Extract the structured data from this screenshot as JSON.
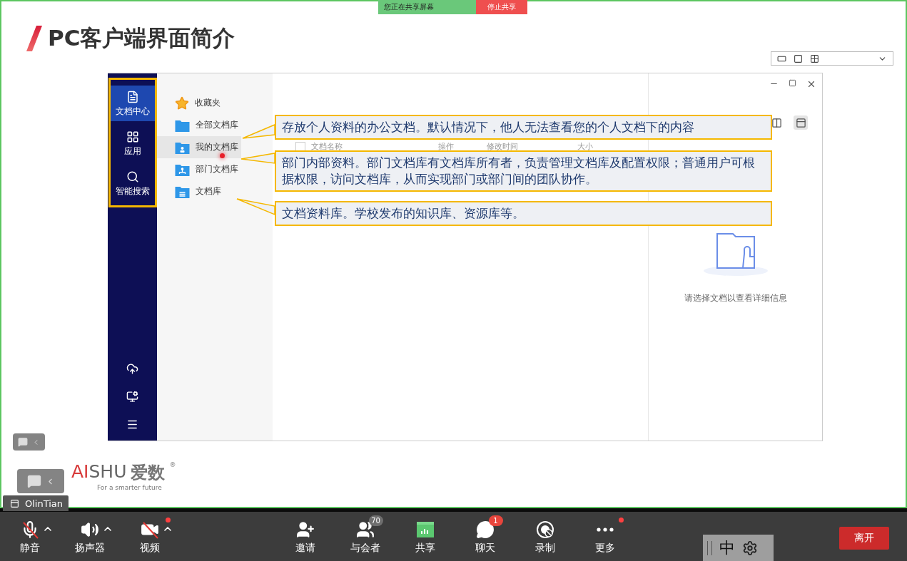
{
  "share_bar": {
    "status": "您正在共享屏幕",
    "stop_button": "停止共享"
  },
  "slide": {
    "title": "PC客户端界面简介",
    "app_window": {
      "rail_items": [
        {
          "label": "文档中心",
          "kind": "doc",
          "selected": true
        },
        {
          "label": "应用",
          "kind": "apps",
          "selected": false
        },
        {
          "label": "智能搜索",
          "kind": "search",
          "selected": false
        }
      ],
      "nav_items": [
        {
          "label": "收藏夹",
          "kind": "star",
          "selected": false
        },
        {
          "label": "全部文档库",
          "kind": "folder",
          "selected": false
        },
        {
          "label": "我的文档库",
          "kind": "user-folder",
          "selected": true
        },
        {
          "label": "部门文档库",
          "kind": "org-folder",
          "selected": false
        },
        {
          "label": "文档库",
          "kind": "list-folder",
          "selected": false
        }
      ],
      "select_all": {
        "checked": false
      },
      "table_columns": [
        "文档名称",
        "操作",
        "修改时间",
        "大小"
      ],
      "detail_empty_text": "请选择文档以查看详细信息"
    },
    "callouts": [
      {
        "text": "存放个人资料的办公文档。默认情况下，他人无法查看您的个人文档下的内容"
      },
      {
        "text": "部门内部资料。部门文档库有文档库所有者，负责管理文档库及配置权限；普通用户可根据权限，访问文档库，从而实现部门或部门间的团队协作。"
      },
      {
        "text": "文档资料库。学校发布的知识库、资源库等。"
      }
    ],
    "logo": {
      "latin": "AISHU",
      "chinese": "爱数",
      "mark": "®",
      "tagline": "For a smarter future"
    }
  },
  "presenter": "OlinTian",
  "toolbar": {
    "items": [
      {
        "label": "静音",
        "kind": "mic",
        "off": true,
        "caret": true,
        "dot": false
      },
      {
        "label": "扬声器",
        "kind": "speaker",
        "off": false,
        "caret": true,
        "dot": false
      },
      {
        "label": "视频",
        "kind": "video",
        "off": true,
        "caret": true,
        "dot": true
      },
      {
        "label": "邀请",
        "kind": "invite",
        "off": false,
        "caret": false,
        "dot": false
      },
      {
        "label": "与会者",
        "kind": "participants",
        "off": false,
        "caret": false,
        "dot": false,
        "badge": {
          "text": "70",
          "color": "#6e6e6e"
        }
      },
      {
        "label": "共享",
        "kind": "share",
        "off": false,
        "caret": false,
        "dot": false
      },
      {
        "label": "聊天",
        "kind": "chat",
        "off": false,
        "caret": false,
        "dot": false,
        "badge": {
          "text": "1",
          "color": "#e8453c"
        }
      },
      {
        "label": "录制",
        "kind": "record",
        "off": false,
        "caret": false,
        "dot": false
      },
      {
        "label": "更多",
        "kind": "more",
        "off": false,
        "caret": false,
        "dot": true
      }
    ],
    "ime": "中",
    "leave_button": "离开"
  }
}
